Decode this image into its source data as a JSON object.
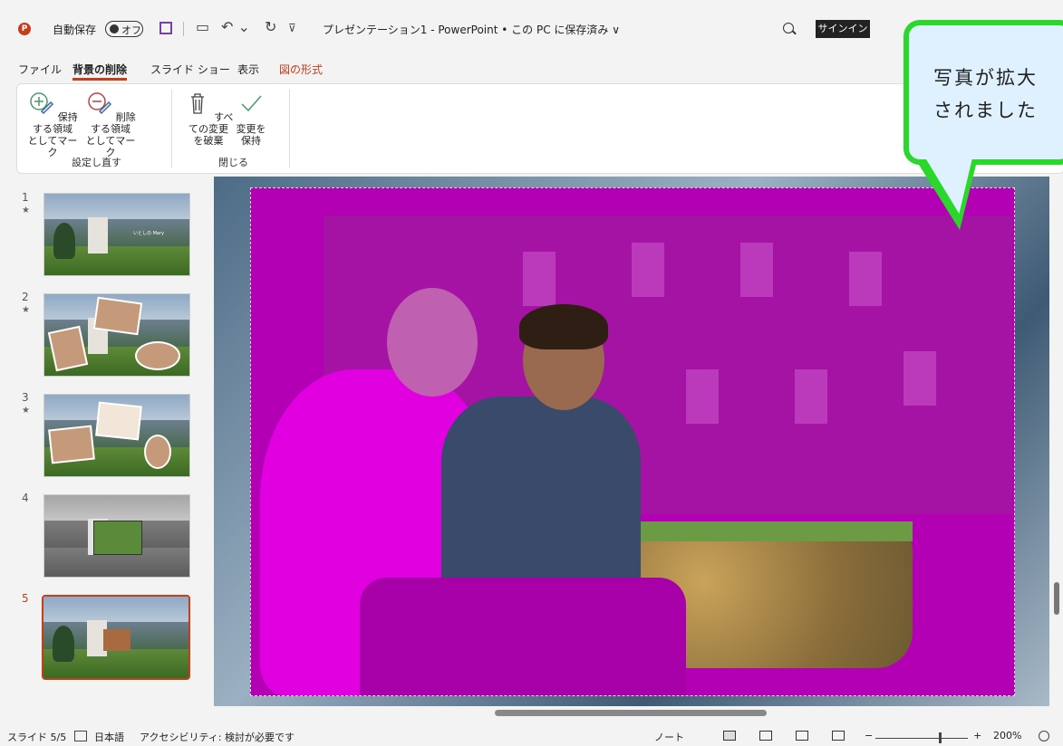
{
  "titlebar": {
    "app_letter": "P",
    "autosave_label": "自動保存",
    "autosave_state": "オフ",
    "doc_title": "プレゼンテーション1 - PowerPoint • この PC に保存済み ∨",
    "signin": "サインイン",
    "undo_glyph": "↶ ⌄",
    "redo_glyph": "↻",
    "more_glyph": "⊽",
    "present_glyph": "▭"
  },
  "menu": {
    "file": "ファイル",
    "remove_bg": "背景の削除",
    "slideshow": "スライド ショー",
    "view": "表示",
    "picture_format": "図の形式"
  },
  "ribbon": {
    "keep": "保持する領域\nとしてマーク",
    "remove": "削除する領域\nとしてマーク",
    "discard": "すべての変更\nを破棄",
    "keep_changes": "変更を\n保持",
    "group_refine": "設定し直す",
    "group_close": "閉じる"
  },
  "slides": [
    {
      "num": "1",
      "star": "★"
    },
    {
      "num": "2",
      "star": "★"
    },
    {
      "num": "3",
      "star": "★"
    },
    {
      "num": "4",
      "star": ""
    },
    {
      "num": "5",
      "star": ""
    }
  ],
  "slide1_caption": "いとしの Mary",
  "callout": {
    "line1": "写真が拡大",
    "line2": "されました"
  },
  "status": {
    "slide_pos": "スライド 5/5",
    "language": "日本語",
    "accessibility": "アクセシビリティ: 検討が必要です",
    "notes": "ノート",
    "zoom": "200%"
  },
  "colors": {
    "accent": "#c43e1c",
    "removal_overlay": "#b400b4",
    "callout_border": "#2ad72a"
  }
}
